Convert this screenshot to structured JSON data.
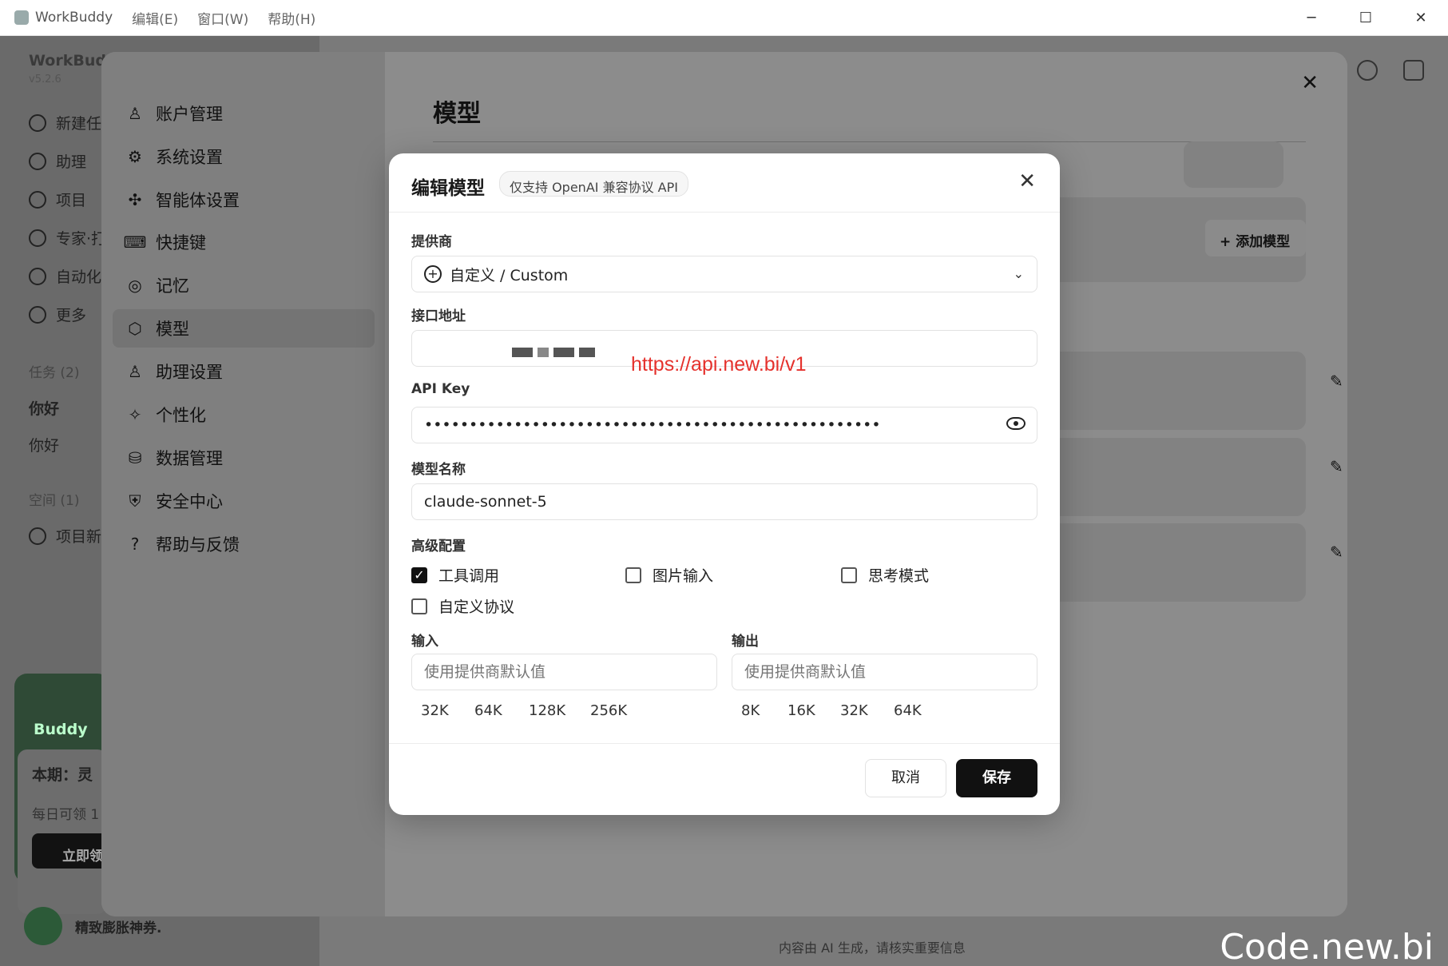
{
  "titlebar": {
    "app_name": "WorkBuddy",
    "menus": [
      "编辑(E)",
      "窗口(W)",
      "帮助(H)"
    ],
    "minimize": "─",
    "maximize": "☐",
    "close": "✕"
  },
  "background": {
    "brand": "WorkBudd",
    "version": "v5.2.6",
    "nav": [
      "新建任",
      "助理",
      "项目",
      "专家·打",
      "自动化",
      "更多"
    ],
    "tasks_section": "任务 (2)",
    "tasks": [
      "你好",
      "你好"
    ],
    "space_section": "空间 (1)",
    "space_items": [
      "项目新"
    ],
    "promo": {
      "header": "Buddy",
      "title": "本期：灵",
      "subtitle": "每日可领 1",
      "button": "立即领"
    },
    "bottom_text": "精致膨胀神券.",
    "footer_note": "内容由 AI 生成，请核实重要信息"
  },
  "settings": {
    "nav": [
      {
        "label": "账户管理",
        "icon": "user-icon"
      },
      {
        "label": "系统设置",
        "icon": "gear-icon"
      },
      {
        "label": "智能体设置",
        "icon": "puzzle-icon"
      },
      {
        "label": "快捷键",
        "icon": "keyboard-icon"
      },
      {
        "label": "记忆",
        "icon": "memory-icon"
      },
      {
        "label": "模型",
        "icon": "cube-icon",
        "active": true
      },
      {
        "label": "助理设置",
        "icon": "assistant-icon"
      },
      {
        "label": "个性化",
        "icon": "sparkle-icon"
      },
      {
        "label": "数据管理",
        "icon": "database-icon"
      },
      {
        "label": "安全中心",
        "icon": "shield-icon"
      },
      {
        "label": "帮助与反馈",
        "icon": "help-icon"
      }
    ],
    "main_title": "模型",
    "add_model": "+ 添加模型",
    "close": "✕"
  },
  "modal": {
    "title": "编辑模型",
    "chip": "仅支持 OpenAI 兼容协议 API",
    "close": "✕",
    "provider_label": "提供商",
    "provider_value": "自定义 / Custom",
    "endpoint_label": "接口地址",
    "endpoint_value": "https://api.new.bi/v1",
    "apikey_label": "API Key",
    "apikey_value": "•••••••••••••••••••••••••••••••••••••••••••••••••••",
    "model_name_label": "模型名称",
    "model_name_value": "claude-sonnet-5",
    "advanced_label": "高级配置",
    "options": [
      {
        "label": "工具调用",
        "checked": true
      },
      {
        "label": "图片输入",
        "checked": false
      },
      {
        "label": "思考模式",
        "checked": false
      },
      {
        "label": "自定义协议",
        "checked": false
      }
    ],
    "input_label": "输入",
    "input_placeholder": "使用提供商默认值",
    "input_presets": [
      "32K",
      "64K",
      "128K",
      "256K"
    ],
    "output_label": "输出",
    "output_placeholder": "使用提供商默认值",
    "output_presets": [
      "8K",
      "16K",
      "32K",
      "64K"
    ],
    "cancel": "取消",
    "save": "保存"
  },
  "watermark": "Code.new.bi",
  "colors": {
    "primary_button": "#111111",
    "overlay_url": "#e5322d"
  }
}
